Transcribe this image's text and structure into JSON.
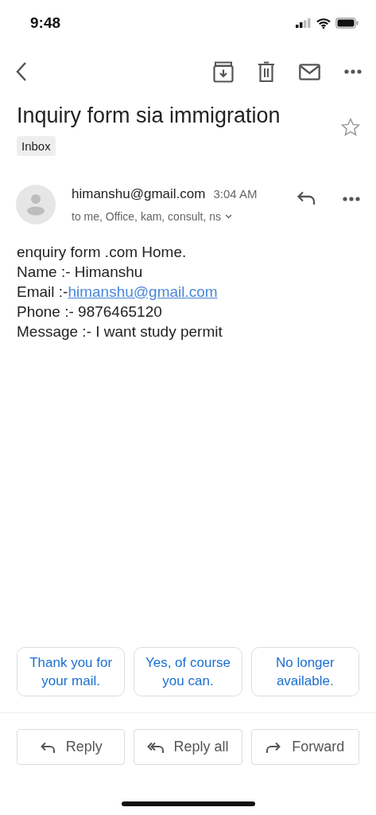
{
  "status_bar": {
    "time": "9:48"
  },
  "subject": "Inquiry form sia immigration",
  "label": "Inbox",
  "starred": false,
  "message": {
    "sender": "himanshu@gmail.com",
    "time": "3:04 AM",
    "recipients": "to me, Office, kam, consult, ns",
    "body": [
      {
        "kind": "text",
        "text": "enquiry form .com Home."
      },
      {
        "kind": "text",
        "text": "Name :- Himanshu"
      },
      {
        "kind": "link",
        "text": "Email :-",
        "link": "himanshu@gmail.com"
      },
      {
        "kind": "text",
        "text": "Phone :- 9876465120"
      },
      {
        "kind": "text",
        "text": "Message :- I want study permit"
      }
    ]
  },
  "smart_replies": [
    "Thank you for your mail.",
    "Yes, of course you can.",
    "No longer available."
  ],
  "actions": [
    {
      "kind": "reply",
      "label": "Reply"
    },
    {
      "kind": "reply_all",
      "label": "Reply all"
    },
    {
      "kind": "forward",
      "label": "Forward"
    }
  ]
}
